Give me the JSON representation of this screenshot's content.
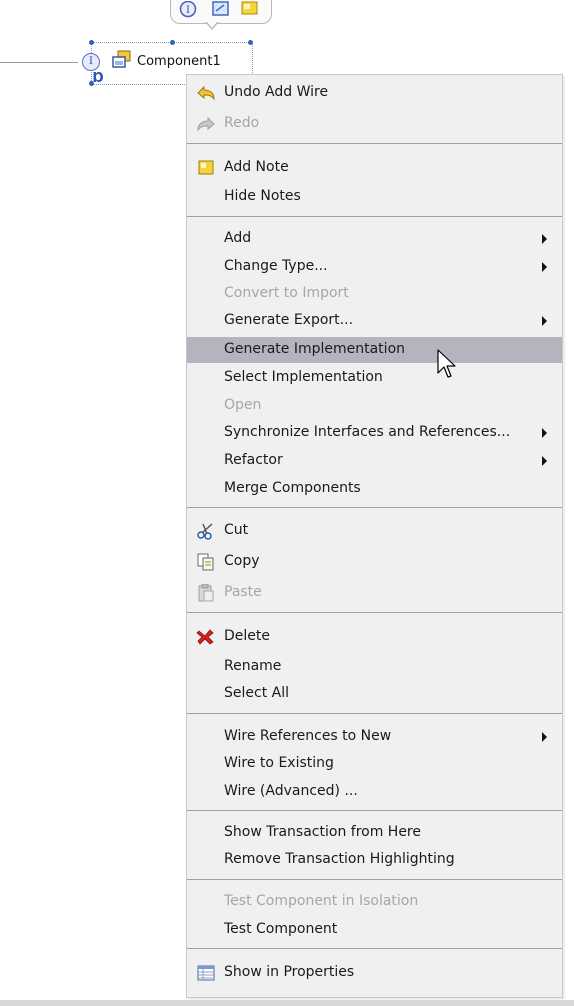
{
  "component": {
    "name": "Component1",
    "icon": "component-icon",
    "interface_icon": "interface-circle-icon",
    "reference_icon": "reference-icon"
  },
  "palette": {
    "icons": [
      "interface-icon",
      "reference-icon",
      "note-icon"
    ]
  },
  "menu": {
    "highlight_color": "#b7b3be",
    "disabled_color": "#a6a6a6",
    "items": [
      {
        "label": "Undo Add Wire",
        "icon": "undo-icon",
        "disabled": false,
        "submenu": false
      },
      {
        "label": "Redo",
        "icon": "redo-icon",
        "disabled": true,
        "submenu": false
      },
      {
        "label": "Add Note",
        "icon": "note-icon",
        "disabled": false,
        "submenu": false
      },
      {
        "label": "Hide Notes",
        "icon": "",
        "disabled": false,
        "submenu": false
      },
      {
        "label": "Add",
        "icon": "",
        "disabled": false,
        "submenu": true
      },
      {
        "label": "Change Type...",
        "icon": "",
        "disabled": false,
        "submenu": true
      },
      {
        "label": "Convert to Import",
        "icon": "",
        "disabled": true,
        "submenu": false
      },
      {
        "label": "Generate Export...",
        "icon": "",
        "disabled": false,
        "submenu": true
      },
      {
        "label": "Generate Implementation",
        "icon": "",
        "disabled": false,
        "submenu": false,
        "highlighted": true
      },
      {
        "label": "Select Implementation",
        "icon": "",
        "disabled": false,
        "submenu": false
      },
      {
        "label": "Open",
        "icon": "",
        "disabled": true,
        "submenu": false
      },
      {
        "label": "Synchronize Interfaces and References...",
        "icon": "",
        "disabled": false,
        "submenu": true
      },
      {
        "label": "Refactor",
        "icon": "",
        "disabled": false,
        "submenu": true
      },
      {
        "label": "Merge Components",
        "icon": "",
        "disabled": false,
        "submenu": false
      },
      {
        "label": "Cut",
        "icon": "scissors-icon",
        "disabled": false,
        "submenu": false
      },
      {
        "label": "Copy",
        "icon": "copy-icon",
        "disabled": false,
        "submenu": false
      },
      {
        "label": "Paste",
        "icon": "paste-icon",
        "disabled": true,
        "submenu": false
      },
      {
        "label": "Delete",
        "icon": "delete-x-icon",
        "disabled": false,
        "submenu": false
      },
      {
        "label": "Rename",
        "icon": "",
        "disabled": false,
        "submenu": false
      },
      {
        "label": "Select All",
        "icon": "",
        "disabled": false,
        "submenu": false
      },
      {
        "label": "Wire References to New",
        "icon": "",
        "disabled": false,
        "submenu": true
      },
      {
        "label": "Wire to Existing",
        "icon": "",
        "disabled": false,
        "submenu": false
      },
      {
        "label": "Wire (Advanced) ...",
        "icon": "",
        "disabled": false,
        "submenu": false
      },
      {
        "label": "Show Transaction from Here",
        "icon": "",
        "disabled": false,
        "submenu": false
      },
      {
        "label": "Remove Transaction Highlighting",
        "icon": "",
        "disabled": false,
        "submenu": false
      },
      {
        "label": "Test Component in Isolation",
        "icon": "",
        "disabled": true,
        "submenu": false
      },
      {
        "label": "Test Component",
        "icon": "",
        "disabled": false,
        "submenu": false
      },
      {
        "label": "Show in Properties",
        "icon": "properties-table-icon",
        "disabled": false,
        "submenu": false
      }
    ]
  },
  "cursor": {
    "icon": "mouse-pointer-icon"
  }
}
